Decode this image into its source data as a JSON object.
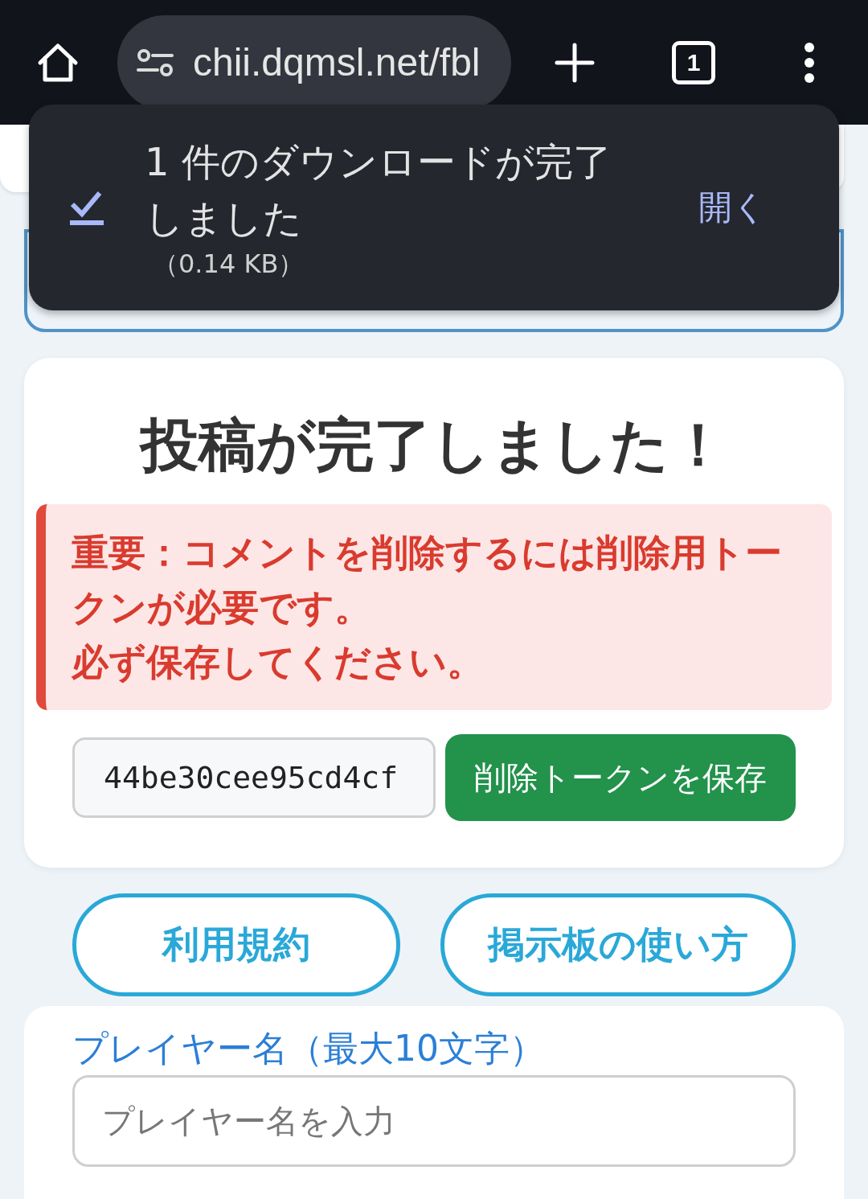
{
  "browser": {
    "url": "chii.dqmsl.net/fbl",
    "tab_count": "1"
  },
  "download_toast": {
    "message": "1 件のダウンロードが完了しました",
    "size": "（0.14 KB）",
    "action": "開く"
  },
  "success_card": {
    "title": "投稿が完了しました！",
    "alert_lines": [
      "重要：コメントを削除するには削除用トークンが必要です。",
      "必ず保存してください。"
    ],
    "token": "44be30cee95cd4cf",
    "save_button": "削除トークンを保存"
  },
  "links": [
    "利用規約",
    "掲示板の使い方"
  ],
  "form": {
    "label": "プレイヤー名（最大10文字）",
    "placeholder": "プレイヤー名を入力"
  }
}
